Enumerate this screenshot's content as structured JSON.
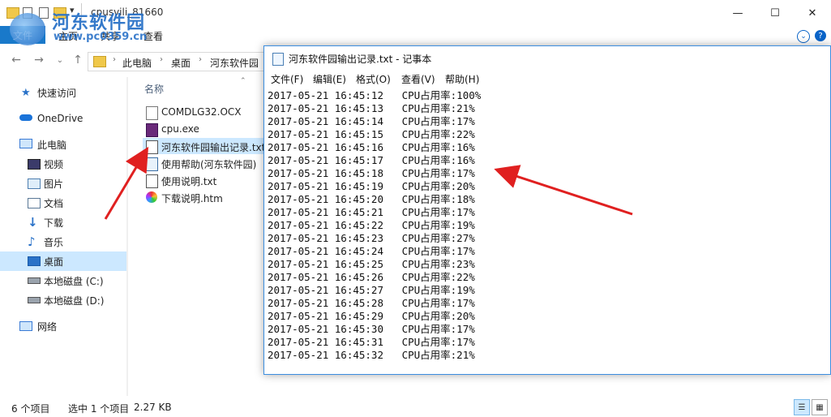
{
  "explorer": {
    "window_title": "cpusvili_81660",
    "controls": {
      "minimize": "—",
      "maximize": "☐",
      "close": "✕"
    },
    "ribbon": {
      "file": "文件",
      "home": "主页",
      "share": "共享",
      "view": "查看"
    },
    "address": {
      "crumbs": [
        "此电脑",
        "桌面",
        "河东软件园"
      ]
    },
    "sidebar": {
      "items": [
        {
          "label": "快速访问"
        },
        {
          "label": "OneDrive"
        },
        {
          "label": "此电脑"
        },
        {
          "label": "视频"
        },
        {
          "label": "图片"
        },
        {
          "label": "文档"
        },
        {
          "label": "下载"
        },
        {
          "label": "音乐"
        },
        {
          "label": "桌面"
        },
        {
          "label": "本地磁盘 (C:)"
        },
        {
          "label": "本地磁盘 (D:)"
        },
        {
          "label": "网络"
        }
      ]
    },
    "column_header": "名称",
    "files": [
      {
        "name": "COMDLG32.OCX"
      },
      {
        "name": "cpu.exe"
      },
      {
        "name": "河东软件园输出记录.txt"
      },
      {
        "name": "使用帮助(河东软件园)"
      },
      {
        "name": "使用说明.txt"
      },
      {
        "name": "下载说明.htm"
      }
    ],
    "status": {
      "count": "6 个项目",
      "selected": "选中 1 个项目",
      "size": "2.27 KB"
    }
  },
  "notepad": {
    "title": "河东软件园输出记录.txt - 记事本",
    "menu": [
      "文件(F)",
      "编辑(E)",
      "格式(O)",
      "查看(V)",
      "帮助(H)"
    ],
    "lines": [
      "2017-05-21 16:45:12   CPU占用率:100%",
      "2017-05-21 16:45:13   CPU占用率:21%",
      "2017-05-21 16:45:14   CPU占用率:17%",
      "2017-05-21 16:45:15   CPU占用率:22%",
      "2017-05-21 16:45:16   CPU占用率:16%",
      "2017-05-21 16:45:17   CPU占用率:16%",
      "2017-05-21 16:45:18   CPU占用率:17%",
      "2017-05-21 16:45:19   CPU占用率:20%",
      "2017-05-21 16:45:20   CPU占用率:18%",
      "2017-05-21 16:45:21   CPU占用率:17%",
      "2017-05-21 16:45:22   CPU占用率:19%",
      "2017-05-21 16:45:23   CPU占用率:27%",
      "2017-05-21 16:45:24   CPU占用率:17%",
      "2017-05-21 16:45:25   CPU占用率:23%",
      "2017-05-21 16:45:26   CPU占用率:22%",
      "2017-05-21 16:45:27   CPU占用率:19%",
      "2017-05-21 16:45:28   CPU占用率:17%",
      "2017-05-21 16:45:29   CPU占用率:20%",
      "2017-05-21 16:45:30   CPU占用率:17%",
      "2017-05-21 16:45:31   CPU占用率:17%",
      "2017-05-21 16:45:32   CPU占用率:21%"
    ]
  },
  "watermark": {
    "text": "河东软件园",
    "url": "www.pc0359.cn"
  },
  "colors": {
    "accent": "#1979ca",
    "selection": "#cce8ff",
    "arrow": "#e02020"
  },
  "icons": [
    "pin-icon",
    "cloud-icon",
    "computer-icon",
    "video-icon",
    "picture-icon",
    "document-icon",
    "download-icon",
    "music-icon",
    "desktop-icon",
    "drive-icon",
    "network-icon"
  ]
}
